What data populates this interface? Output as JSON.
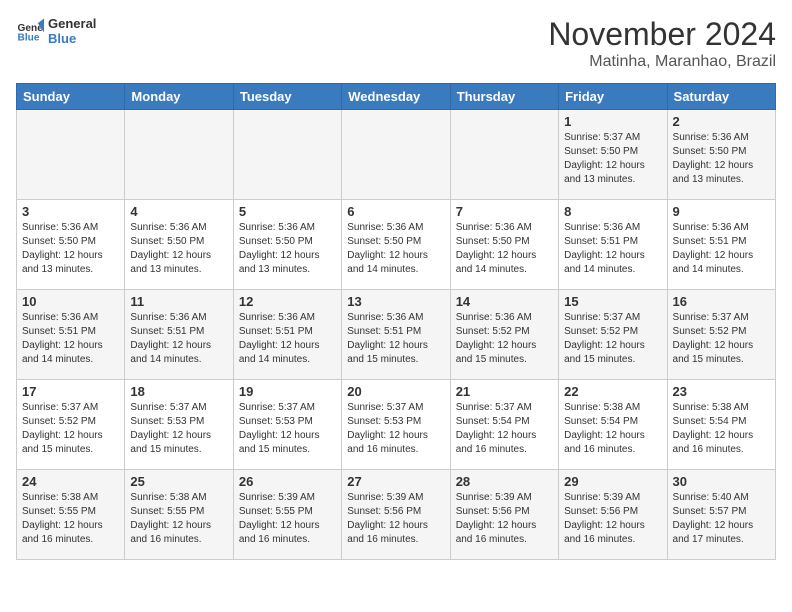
{
  "logo": {
    "line1": "General",
    "line2": "Blue"
  },
  "title": "November 2024",
  "location": "Matinha, Maranhao, Brazil",
  "weekdays": [
    "Sunday",
    "Monday",
    "Tuesday",
    "Wednesday",
    "Thursday",
    "Friday",
    "Saturday"
  ],
  "weeks": [
    [
      {
        "day": "",
        "info": ""
      },
      {
        "day": "",
        "info": ""
      },
      {
        "day": "",
        "info": ""
      },
      {
        "day": "",
        "info": ""
      },
      {
        "day": "",
        "info": ""
      },
      {
        "day": "1",
        "info": "Sunrise: 5:37 AM\nSunset: 5:50 PM\nDaylight: 12 hours\nand 13 minutes."
      },
      {
        "day": "2",
        "info": "Sunrise: 5:36 AM\nSunset: 5:50 PM\nDaylight: 12 hours\nand 13 minutes."
      }
    ],
    [
      {
        "day": "3",
        "info": "Sunrise: 5:36 AM\nSunset: 5:50 PM\nDaylight: 12 hours\nand 13 minutes."
      },
      {
        "day": "4",
        "info": "Sunrise: 5:36 AM\nSunset: 5:50 PM\nDaylight: 12 hours\nand 13 minutes."
      },
      {
        "day": "5",
        "info": "Sunrise: 5:36 AM\nSunset: 5:50 PM\nDaylight: 12 hours\nand 13 minutes."
      },
      {
        "day": "6",
        "info": "Sunrise: 5:36 AM\nSunset: 5:50 PM\nDaylight: 12 hours\nand 14 minutes."
      },
      {
        "day": "7",
        "info": "Sunrise: 5:36 AM\nSunset: 5:50 PM\nDaylight: 12 hours\nand 14 minutes."
      },
      {
        "day": "8",
        "info": "Sunrise: 5:36 AM\nSunset: 5:51 PM\nDaylight: 12 hours\nand 14 minutes."
      },
      {
        "day": "9",
        "info": "Sunrise: 5:36 AM\nSunset: 5:51 PM\nDaylight: 12 hours\nand 14 minutes."
      }
    ],
    [
      {
        "day": "10",
        "info": "Sunrise: 5:36 AM\nSunset: 5:51 PM\nDaylight: 12 hours\nand 14 minutes."
      },
      {
        "day": "11",
        "info": "Sunrise: 5:36 AM\nSunset: 5:51 PM\nDaylight: 12 hours\nand 14 minutes."
      },
      {
        "day": "12",
        "info": "Sunrise: 5:36 AM\nSunset: 5:51 PM\nDaylight: 12 hours\nand 14 minutes."
      },
      {
        "day": "13",
        "info": "Sunrise: 5:36 AM\nSunset: 5:51 PM\nDaylight: 12 hours\nand 15 minutes."
      },
      {
        "day": "14",
        "info": "Sunrise: 5:36 AM\nSunset: 5:52 PM\nDaylight: 12 hours\nand 15 minutes."
      },
      {
        "day": "15",
        "info": "Sunrise: 5:37 AM\nSunset: 5:52 PM\nDaylight: 12 hours\nand 15 minutes."
      },
      {
        "day": "16",
        "info": "Sunrise: 5:37 AM\nSunset: 5:52 PM\nDaylight: 12 hours\nand 15 minutes."
      }
    ],
    [
      {
        "day": "17",
        "info": "Sunrise: 5:37 AM\nSunset: 5:52 PM\nDaylight: 12 hours\nand 15 minutes."
      },
      {
        "day": "18",
        "info": "Sunrise: 5:37 AM\nSunset: 5:53 PM\nDaylight: 12 hours\nand 15 minutes."
      },
      {
        "day": "19",
        "info": "Sunrise: 5:37 AM\nSunset: 5:53 PM\nDaylight: 12 hours\nand 15 minutes."
      },
      {
        "day": "20",
        "info": "Sunrise: 5:37 AM\nSunset: 5:53 PM\nDaylight: 12 hours\nand 16 minutes."
      },
      {
        "day": "21",
        "info": "Sunrise: 5:37 AM\nSunset: 5:54 PM\nDaylight: 12 hours\nand 16 minutes."
      },
      {
        "day": "22",
        "info": "Sunrise: 5:38 AM\nSunset: 5:54 PM\nDaylight: 12 hours\nand 16 minutes."
      },
      {
        "day": "23",
        "info": "Sunrise: 5:38 AM\nSunset: 5:54 PM\nDaylight: 12 hours\nand 16 minutes."
      }
    ],
    [
      {
        "day": "24",
        "info": "Sunrise: 5:38 AM\nSunset: 5:55 PM\nDaylight: 12 hours\nand 16 minutes."
      },
      {
        "day": "25",
        "info": "Sunrise: 5:38 AM\nSunset: 5:55 PM\nDaylight: 12 hours\nand 16 minutes."
      },
      {
        "day": "26",
        "info": "Sunrise: 5:39 AM\nSunset: 5:55 PM\nDaylight: 12 hours\nand 16 minutes."
      },
      {
        "day": "27",
        "info": "Sunrise: 5:39 AM\nSunset: 5:56 PM\nDaylight: 12 hours\nand 16 minutes."
      },
      {
        "day": "28",
        "info": "Sunrise: 5:39 AM\nSunset: 5:56 PM\nDaylight: 12 hours\nand 16 minutes."
      },
      {
        "day": "29",
        "info": "Sunrise: 5:39 AM\nSunset: 5:56 PM\nDaylight: 12 hours\nand 16 minutes."
      },
      {
        "day": "30",
        "info": "Sunrise: 5:40 AM\nSunset: 5:57 PM\nDaylight: 12 hours\nand 17 minutes."
      }
    ]
  ]
}
